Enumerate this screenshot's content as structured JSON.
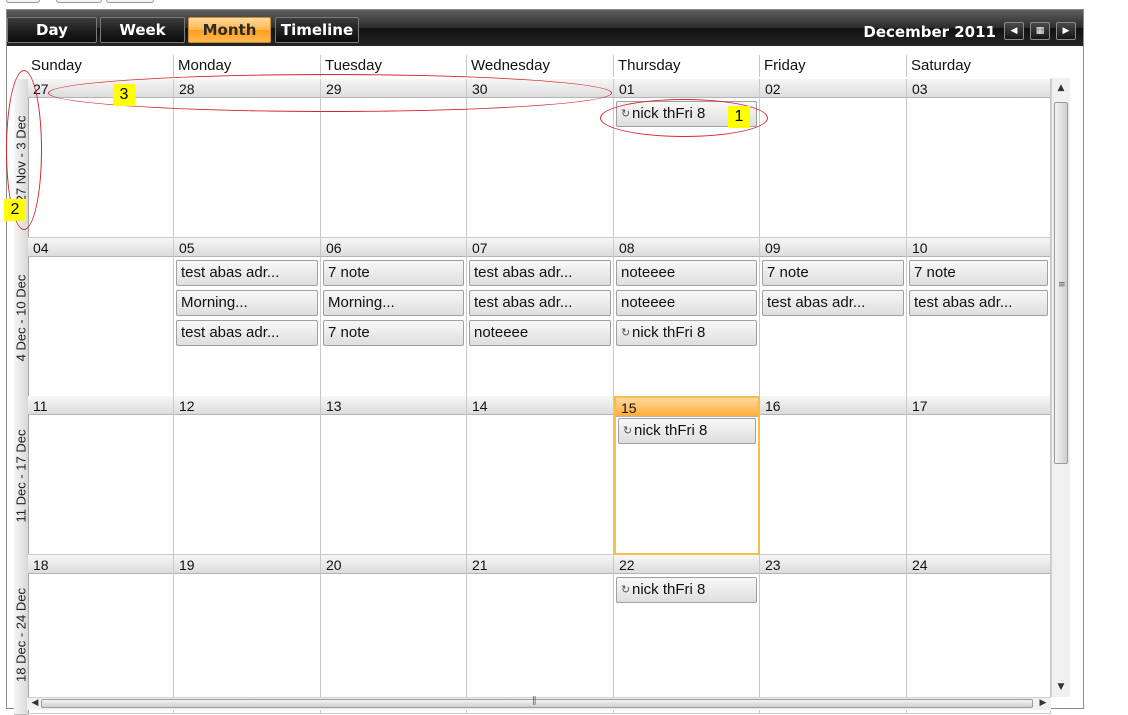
{
  "toolbar": {
    "views": [
      {
        "label": "Day",
        "active": false
      },
      {
        "label": "Week",
        "active": false
      },
      {
        "label": "Month",
        "active": true
      },
      {
        "label": "Timeline",
        "active": false
      }
    ],
    "period": "December 2011",
    "nav": {
      "prev_icon": "triangle-left-icon",
      "today_icon": "calendar-grid-icon",
      "next_icon": "triangle-right-icon"
    }
  },
  "day_names": [
    "Sunday",
    "Monday",
    "Tuesday",
    "Wednesday",
    "Thursday",
    "Friday",
    "Saturday"
  ],
  "weeks": [
    {
      "label": "27 Nov - 3 Dec",
      "days": [
        {
          "num": "27",
          "appts": []
        },
        {
          "num": "28",
          "appts": []
        },
        {
          "num": "29",
          "appts": []
        },
        {
          "num": "30",
          "appts": []
        },
        {
          "num": "01",
          "appts": [
            {
              "text": "nick thFri 8",
              "recurring": true
            }
          ]
        },
        {
          "num": "02",
          "appts": []
        },
        {
          "num": "03",
          "appts": []
        }
      ]
    },
    {
      "label": "4 Dec - 10 Dec",
      "days": [
        {
          "num": "04",
          "appts": []
        },
        {
          "num": "05",
          "appts": [
            {
              "text": "test abas adr...",
              "recurring": false
            },
            {
              "text": "Morning...",
              "recurring": false
            },
            {
              "text": "test abas adr...",
              "recurring": false
            }
          ]
        },
        {
          "num": "06",
          "appts": [
            {
              "text": "7 note",
              "recurring": false
            },
            {
              "text": "Morning...",
              "recurring": false
            },
            {
              "text": "7 note",
              "recurring": false
            }
          ]
        },
        {
          "num": "07",
          "appts": [
            {
              "text": "test abas adr...",
              "recurring": false
            },
            {
              "text": "test abas adr...",
              "recurring": false
            },
            {
              "text": "noteeee",
              "recurring": false
            }
          ]
        },
        {
          "num": "08",
          "appts": [
            {
              "text": "noteeee",
              "recurring": false
            },
            {
              "text": "noteeee",
              "recurring": false
            },
            {
              "text": "nick thFri 8",
              "recurring": true
            }
          ]
        },
        {
          "num": "09",
          "appts": [
            {
              "text": "7 note",
              "recurring": false
            },
            {
              "text": "test abas adr...",
              "recurring": false
            }
          ]
        },
        {
          "num": "10",
          "appts": [
            {
              "text": "7 note",
              "recurring": false
            },
            {
              "text": "test abas adr...",
              "recurring": false
            }
          ]
        }
      ]
    },
    {
      "label": "11 Dec - 17 Dec",
      "days": [
        {
          "num": "11",
          "appts": []
        },
        {
          "num": "12",
          "appts": []
        },
        {
          "num": "13",
          "appts": []
        },
        {
          "num": "14",
          "appts": []
        },
        {
          "num": "15",
          "today": true,
          "appts": [
            {
              "text": "nick thFri 8",
              "recurring": true
            }
          ]
        },
        {
          "num": "16",
          "appts": []
        },
        {
          "num": "17",
          "appts": []
        }
      ]
    },
    {
      "label": "18 Dec - 24 Dec",
      "days": [
        {
          "num": "18",
          "appts": []
        },
        {
          "num": "19",
          "appts": []
        },
        {
          "num": "20",
          "appts": []
        },
        {
          "num": "21",
          "appts": []
        },
        {
          "num": "22",
          "appts": [
            {
              "text": "nick thFri 8",
              "recurring": true
            }
          ]
        },
        {
          "num": "23",
          "appts": []
        },
        {
          "num": "24",
          "appts": []
        }
      ]
    }
  ],
  "annotations": [
    {
      "label": "1"
    },
    {
      "label": "2"
    },
    {
      "label": "3"
    }
  ],
  "colors": {
    "highlight": "#ffae3a",
    "annotation_ring": "#d4262c",
    "marker": "#ffff00"
  }
}
